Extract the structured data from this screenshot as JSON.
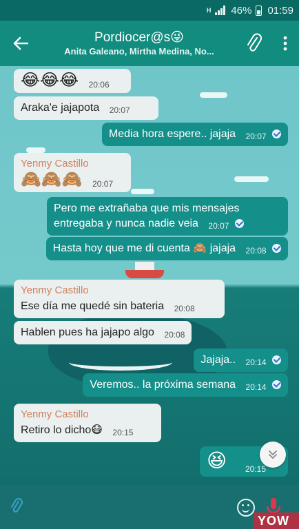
{
  "status": {
    "network": "H",
    "battery": "46%",
    "time": "01:59"
  },
  "header": {
    "title": "Pordiocer@s😜",
    "subtitle": "Anita Galeano, Mirtha Medina, No..."
  },
  "messages": [
    {
      "dir": "in",
      "text": "😂😂😂",
      "time": "20:06"
    },
    {
      "dir": "in",
      "text": "Araka'e jajapota",
      "time": "20:07"
    },
    {
      "dir": "out",
      "text": "Media hora espere.. jajaja",
      "time": "20:07"
    },
    {
      "dir": "in",
      "sender": "Yenmy Castillo",
      "text": "🙈🙈🙈",
      "time": "20:07"
    },
    {
      "dir": "out",
      "text_line1": "Pero me extrañaba que mis mensajes",
      "text_line2": "entregaba y nunca nadie veia",
      "time": "20:07"
    },
    {
      "dir": "out",
      "text": "Hasta hoy que me di cuenta 🙈 jajaja",
      "time": "20:08"
    },
    {
      "dir": "in",
      "sender": "Yenmy Castillo",
      "text": "Ese día me quedé sin bateria",
      "time": "20:08"
    },
    {
      "dir": "in",
      "text": "Hablen pues ha jajapo algo",
      "time": "20:08"
    },
    {
      "dir": "out",
      "text": "Jajaja..",
      "time": "20:14"
    },
    {
      "dir": "out",
      "text": "Veremos.. la próxima semana",
      "time": "20:14"
    },
    {
      "dir": "in",
      "sender": "Yenmy Castillo",
      "text": "Retiro lo dicho😷",
      "time": "20:15"
    },
    {
      "dir": "out",
      "text": "😆",
      "time": "20:15"
    }
  ],
  "icons": {
    "back": "back-arrow-icon",
    "attach": "paperclip-icon",
    "menu": "more-vert-icon",
    "scroll_down": "double-chevron-down-icon",
    "emoji": "smiley-icon",
    "mic": "microphone-icon"
  },
  "watermark": "YOW",
  "colors": {
    "header": "#128c7e",
    "outgoing": "#148f8a",
    "incoming": "#eaf0ef",
    "sender": "#d27f5e",
    "mic": "#e0344f"
  }
}
